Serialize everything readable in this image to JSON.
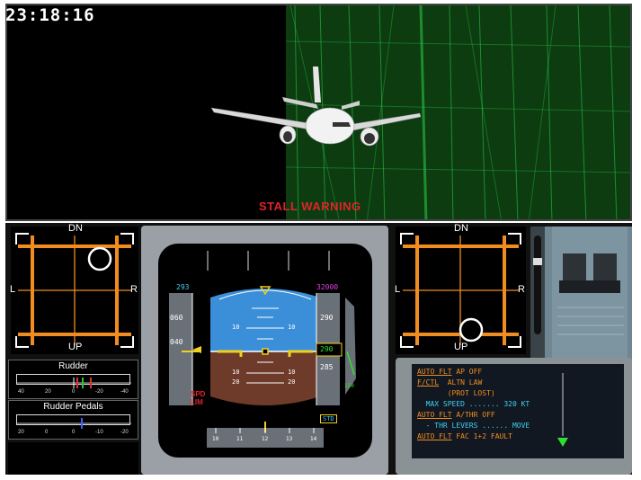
{
  "clock": "23:18:16",
  "warning": "STALL WARNING",
  "sidestick_left": {
    "top": "DN",
    "bottom": "UP",
    "left": "L",
    "right": "R"
  },
  "sidestick_right": {
    "top": "DN",
    "bottom": "UP",
    "left": "L",
    "right": "R"
  },
  "rudder": {
    "title": "Rudder",
    "ticks": [
      "40",
      "20",
      "0",
      "-20",
      "-40"
    ]
  },
  "rudder_pedals": {
    "title": "Rudder Pedals",
    "ticks": [
      "20",
      "0",
      "0",
      "-10",
      "-20"
    ]
  },
  "pfd": {
    "speed_target": "293",
    "speed_labels": [
      "060",
      "040"
    ],
    "spd_lim_line1": "SPD",
    "spd_lim_line2": "LIM",
    "alt_target": "32000",
    "alt_labels": [
      "290",
      "285"
    ],
    "alt_current": "290",
    "vs_value": "150",
    "pitch_labels_upper": [
      "10",
      "10"
    ],
    "pitch_labels_lower": [
      "10",
      "10",
      "20",
      "20"
    ],
    "std_label": "STD",
    "heading_ticks": [
      "10",
      "11",
      "12",
      "13",
      "14"
    ]
  },
  "ecam": [
    {
      "text": "AUTO FLT AP OFF",
      "color": "#f08c20",
      "underline": "AUTO FLT"
    },
    {
      "text": "F/CTL  ALTN LAW",
      "color": "#f08c20",
      "underline": "F/CTL"
    },
    {
      "text": "       (PROT LOST)",
      "color": "#f08c20"
    },
    {
      "text": "  MAX SPEED ....... 320 KT",
      "color": "#3fd0f0"
    },
    {
      "text": "AUTO FLT A/THR OFF",
      "color": "#f08c20",
      "underline": "AUTO FLT"
    },
    {
      "text": "  - THR LEVERS ...... MOVE",
      "color": "#3fd0f0"
    },
    {
      "text": "AUTO FLT FAC 1+2 FAULT",
      "color": "#f08c20",
      "underline": "AUTO FLT"
    }
  ],
  "colors": {
    "amber": "#f08c20",
    "cyan": "#3fd0f0",
    "magenta": "#e040e0",
    "green": "#30e030",
    "warning_red": "#e0242a"
  }
}
